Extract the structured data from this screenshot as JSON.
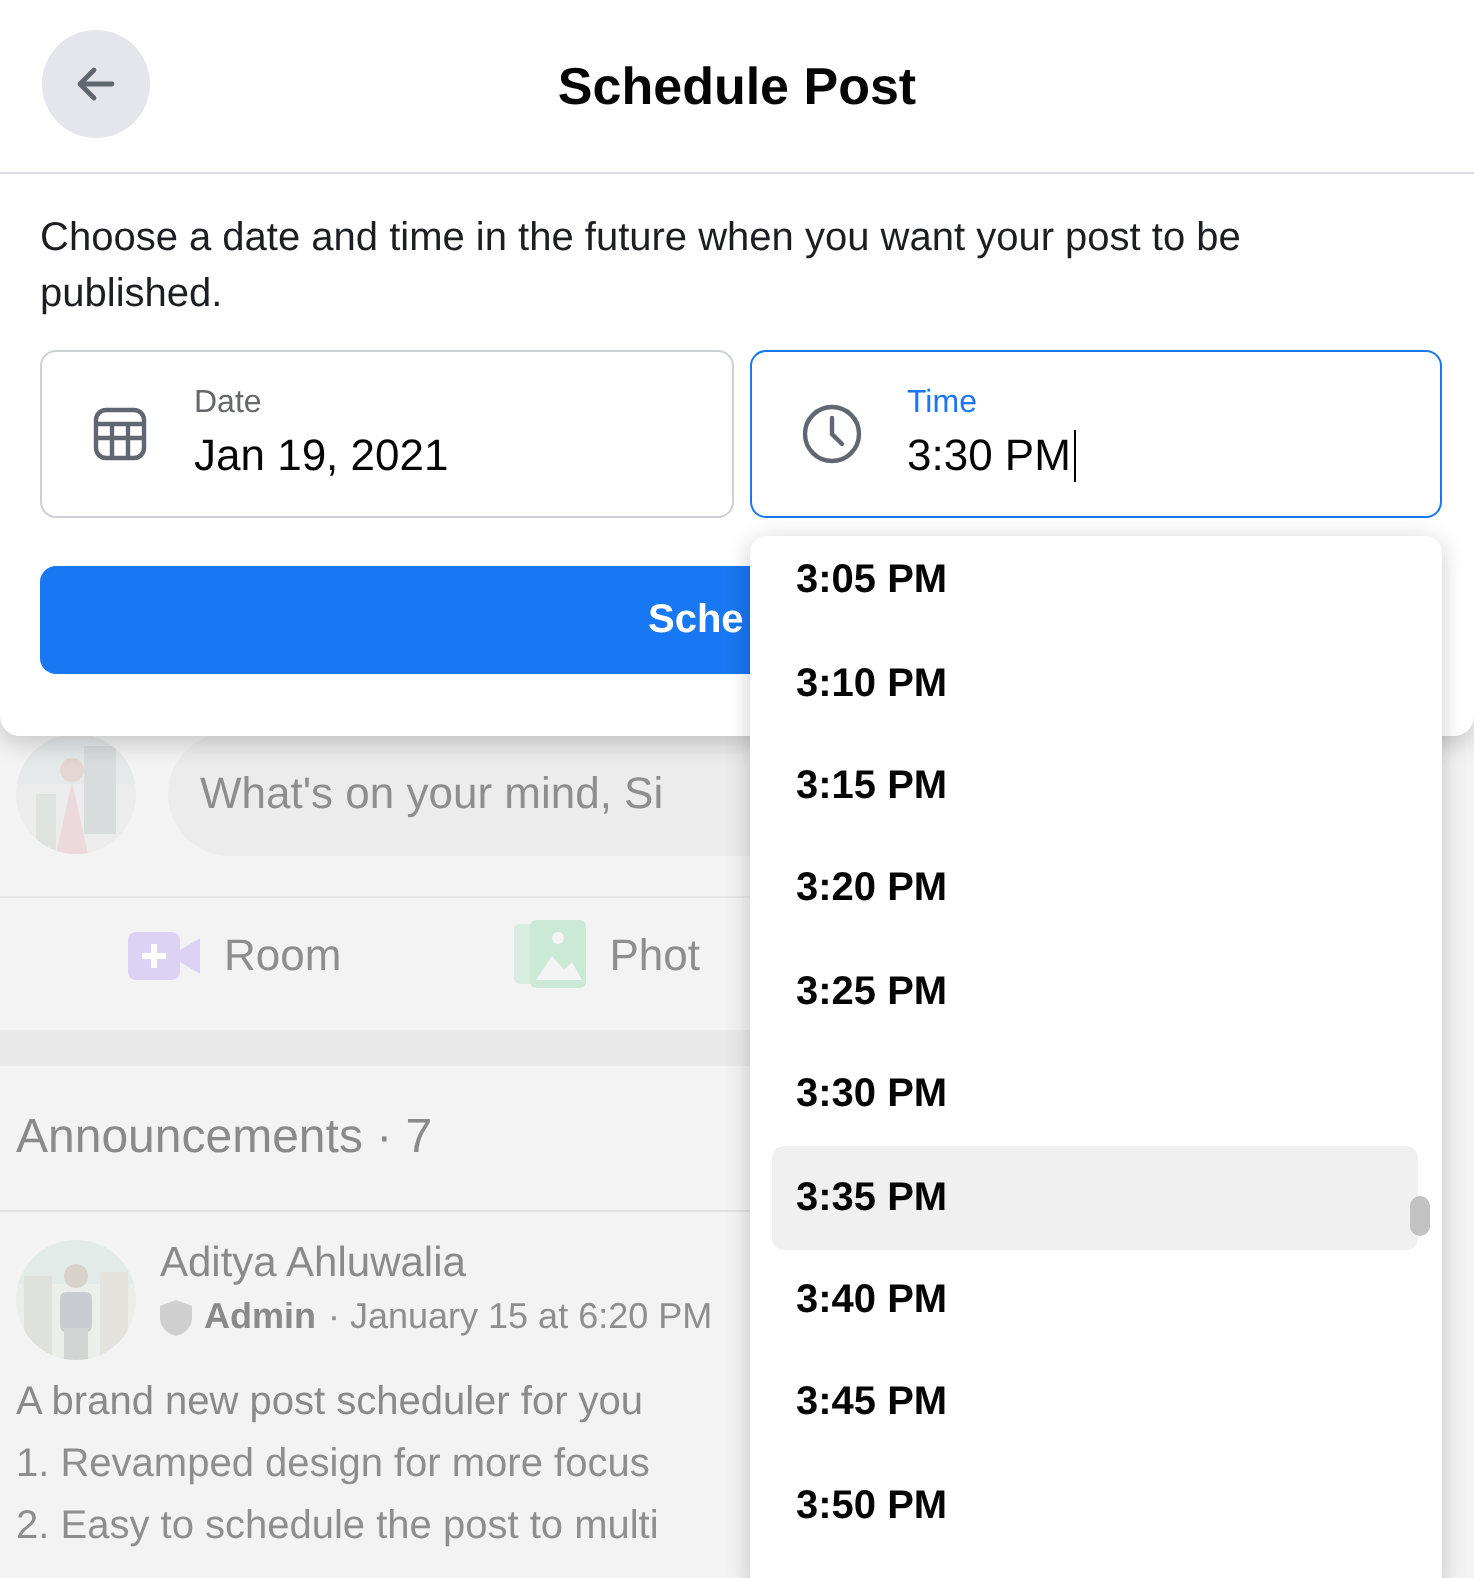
{
  "dialog": {
    "title": "Schedule Post",
    "description": "Choose a date and time in the future when you want your post to be published.",
    "date_field": {
      "label": "Date",
      "value": "Jan 19, 2021",
      "focused": false
    },
    "time_field": {
      "label": "Time",
      "value": "3:30 PM",
      "focused": true
    },
    "submit_button": "Sche"
  },
  "time_options": [
    {
      "label": "3:05 PM",
      "selected": false
    },
    {
      "label": "3:10 PM",
      "selected": false
    },
    {
      "label": "3:15 PM",
      "selected": false
    },
    {
      "label": "3:20 PM",
      "selected": false
    },
    {
      "label": "3:25 PM",
      "selected": false
    },
    {
      "label": "3:30 PM",
      "selected": false
    },
    {
      "label": "3:35 PM",
      "selected": true
    },
    {
      "label": "3:40 PM",
      "selected": false
    },
    {
      "label": "3:45 PM",
      "selected": false
    },
    {
      "label": "3:50 PM",
      "selected": false
    }
  ],
  "background": {
    "composer_placeholder": "What's on your mind, Si",
    "actions": [
      {
        "label": "Room",
        "kind": "room"
      },
      {
        "label": "Phot"
      }
    ],
    "section_title": "Announcements · 7",
    "post": {
      "author": "Aditya Ahluwalia",
      "role": "Admin",
      "meta": "· January 15 at 6:20 PM",
      "text": "A brand new post scheduler for you",
      "lines": [
        "1. Revamped design for more focus",
        "2. Easy to schedule the post to multi"
      ]
    }
  }
}
